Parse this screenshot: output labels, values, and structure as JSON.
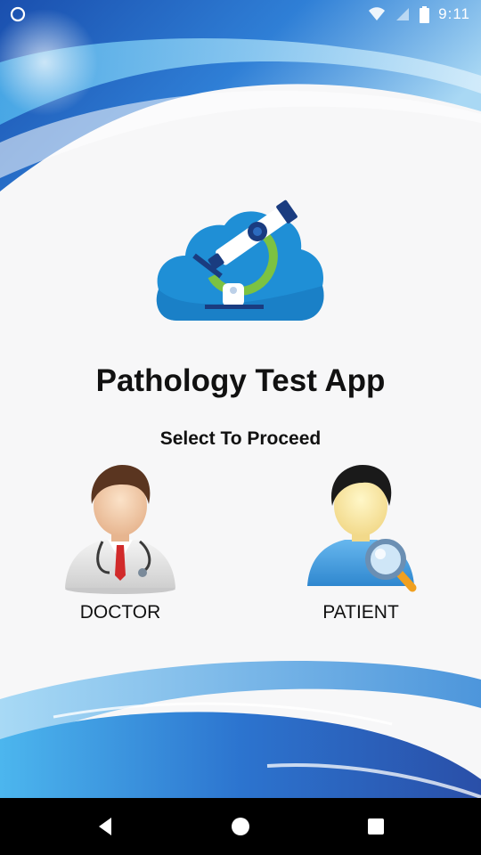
{
  "status_bar": {
    "time": "9:11",
    "icons": [
      "sync-icon",
      "wifi-icon",
      "signal-icon",
      "battery-icon"
    ]
  },
  "app": {
    "title": "Pathology Test App",
    "subtitle": "Select To Proceed",
    "logo_icon": "cloud-microscope-icon"
  },
  "roles": [
    {
      "label": "DOCTOR",
      "icon": "doctor-avatar-icon"
    },
    {
      "label": "PATIENT",
      "icon": "patient-search-avatar-icon"
    }
  ],
  "nav_bar": {
    "buttons": [
      "back-icon",
      "home-icon",
      "recents-icon"
    ]
  },
  "colors": {
    "wave_blue_dark": "#1f56b6",
    "wave_blue_light": "#4aa9e6",
    "cloud_blue": "#1e90d5",
    "background": "#f7f7f8"
  }
}
